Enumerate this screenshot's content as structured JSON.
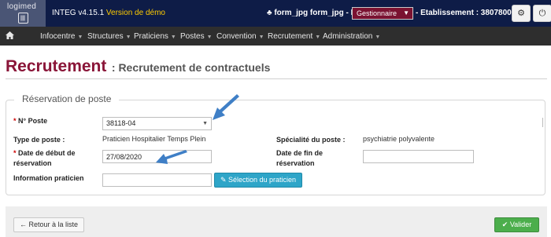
{
  "header": {
    "logo_text": "logimed",
    "logo_badge": "|||",
    "app_name": "INTEG v4.15.1",
    "demo_label": "Version de démo",
    "user": "♣ form_jpg form_jpg - Rôle :",
    "role_value": "Gestionnaire",
    "etablissement": "- Etablissement : 380780080"
  },
  "icons": {
    "settings": "gear-icon",
    "power": "power-icon",
    "home": "home-icon",
    "edit": "pencil-icon",
    "back": "arrow-left-icon",
    "check": "check-icon"
  },
  "nav": {
    "items": [
      {
        "label": "Infocentre"
      },
      {
        "label": "Structures"
      },
      {
        "label": "Praticiens"
      },
      {
        "label": "Postes"
      },
      {
        "label": "Convention"
      },
      {
        "label": "Recrutement"
      },
      {
        "label": "Administration"
      }
    ]
  },
  "page": {
    "title": "Recrutement",
    "subtitle": ": Recrutement de contractuels"
  },
  "form": {
    "legend": "Réservation de poste",
    "poste_label": "N° Poste",
    "poste_value": "38118-04",
    "type_label": "Type de poste :",
    "type_value": "Praticien Hospitalier Temps Plein",
    "specialite_label": "Spécialité du poste :",
    "specialite_value": "psychiatrie polyvalente",
    "date_debut_label_1": "Date de début de",
    "date_debut_label_2": "réservation",
    "date_debut_value": "27/08/2020",
    "date_fin_label_1": "Date de fin de",
    "date_fin_label_2": "réservation",
    "date_fin_value": "",
    "info_label": "Information praticien",
    "info_value": "",
    "select_praticien_label": "Sélection du praticien"
  },
  "footer": {
    "back_label": "Retour à la liste",
    "submit_label": "Valider"
  },
  "colors": {
    "header_bg": "#0e1c47",
    "nav_bg": "#2e2e2e",
    "title_color": "#8a1538",
    "role_bg": "#7a1231",
    "info_button": "#2ea5c8",
    "success_button": "#4cae4c",
    "annotation_arrow": "#3f7fc6"
  }
}
